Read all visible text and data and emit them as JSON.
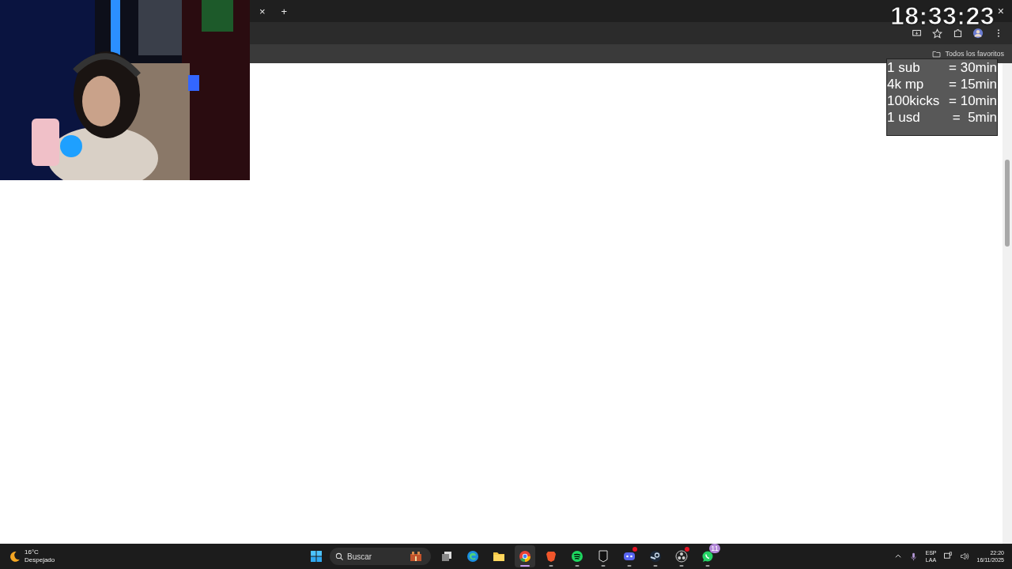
{
  "browser": {
    "tab_close": "×",
    "new_tab": "+",
    "window_close": "×",
    "bookmarks": [
      {
        "label": "Todos los favoritos"
      }
    ]
  },
  "stream_overlay": {
    "clock": "18:33:23",
    "rates": [
      {
        "item": "1 sub",
        "value": "= 30min"
      },
      {
        "item": "4k mp",
        "value": "= 15min"
      },
      {
        "item": "100kicks",
        "value": "= 10min"
      },
      {
        "item": "1 usd",
        "value": "=  5min"
      }
    ]
  },
  "taskbar": {
    "weather": {
      "temperature": "16°C",
      "condition": "Despejado"
    },
    "search": {
      "placeholder": "Buscar"
    },
    "apps": [
      {
        "kind": "taskview",
        "selected": false,
        "running": false
      },
      {
        "kind": "edge",
        "selected": false,
        "running": false
      },
      {
        "kind": "files",
        "selected": false,
        "running": false
      },
      {
        "kind": "chrome",
        "selected": true,
        "running": true
      },
      {
        "kind": "brave",
        "selected": false,
        "running": true
      },
      {
        "kind": "spotify",
        "selected": false,
        "running": true
      },
      {
        "kind": "epic",
        "selected": false,
        "running": true
      },
      {
        "kind": "discord",
        "selected": false,
        "running": true,
        "alert": true
      },
      {
        "kind": "steam",
        "selected": false,
        "running": true
      },
      {
        "kind": "obs",
        "selected": false,
        "running": true,
        "alert": true
      },
      {
        "kind": "whatsapp",
        "selected": false,
        "running": true,
        "badge": "11"
      }
    ],
    "tray": {
      "language": "ESP",
      "layout": "LAA",
      "time": "22:20",
      "date": "16/11/2025"
    }
  }
}
